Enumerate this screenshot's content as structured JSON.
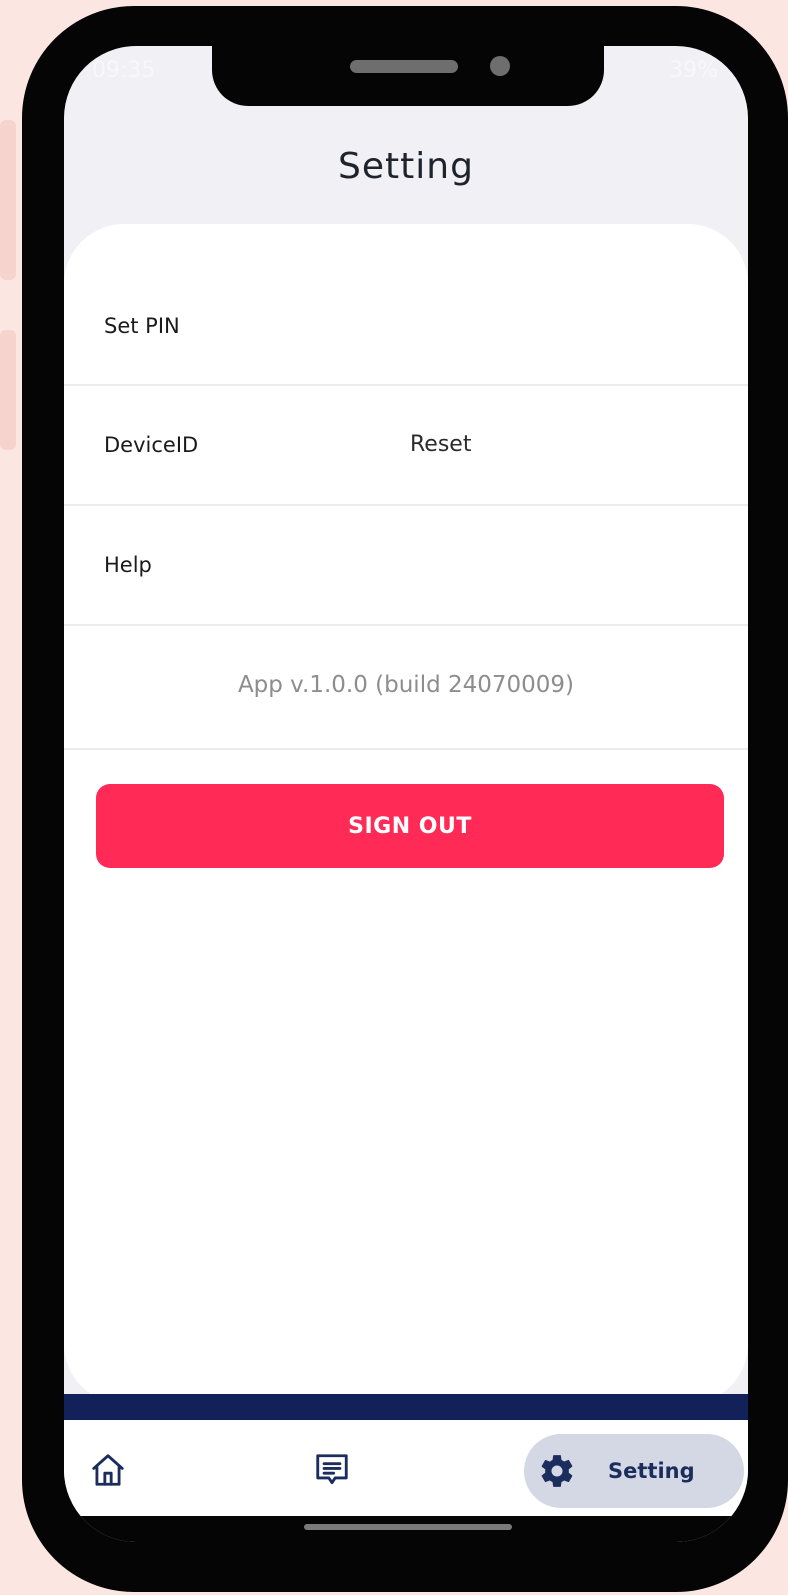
{
  "status_bar": {
    "time": "09:35",
    "battery": "39%"
  },
  "header": {
    "title": "Setting"
  },
  "settings": {
    "items": [
      {
        "label": "Set PIN"
      },
      {
        "label": "DeviceID",
        "action": "Reset"
      },
      {
        "label": "Help"
      }
    ],
    "version": "App v.1.0.0 (build 24070009)"
  },
  "sign_out": {
    "label": "SIGN OUT"
  },
  "bottom_nav": {
    "items": [
      {
        "icon": "home-icon"
      },
      {
        "icon": "message-icon"
      },
      {
        "icon": "gear-icon",
        "label": "Setting",
        "active": true
      }
    ]
  },
  "colors": {
    "background": "#fbe6e2",
    "accent": "#ff2a55",
    "navy": "#12215a",
    "active_pill": "#d4d8e4"
  }
}
